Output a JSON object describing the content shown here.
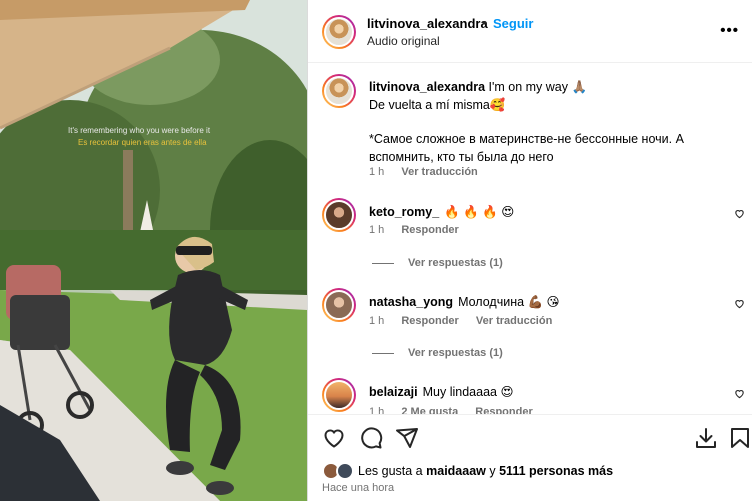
{
  "media": {
    "caption_en": "It's remembering who you were before it",
    "caption_es": "Es recordar quien eras antes de ella"
  },
  "header": {
    "username": "litvinova_alexandra",
    "dot": "•",
    "follow": "Seguir",
    "audio": "Audio original",
    "more": "•••"
  },
  "post": {
    "username": "litvinova_alexandra",
    "line1": "I'm on my way 🙏🏽",
    "line2": "De vuelta a mí misma🥰",
    "line3": "*Самое сложное в материнстве-не бессонные ночи. А вспомнить, кто ты была до него",
    "time": "1 h",
    "translate": "Ver traducción"
  },
  "comments": [
    {
      "username": "keto_romy_",
      "text": "🔥 🔥 🔥 😍",
      "time": "1 h",
      "reply": "Responder",
      "translate": "",
      "replies": "Ver respuestas (1)",
      "avatar_color": "#5a3b2a"
    },
    {
      "username": "natasha_yong",
      "text": "Молодчина 💪🏾 😘",
      "time": "1 h",
      "reply": "Responder",
      "translate": "Ver traducción",
      "replies": "Ver respuestas (1)",
      "avatar_color": "#8a6a55"
    },
    {
      "username": "belaizaji",
      "text": "Muy lindaaaa 😍",
      "time": "1 h",
      "reply": "Responder",
      "likes": "2 Me gusta",
      "avatar_color": "#d9834a"
    }
  ],
  "likes": {
    "prefix": "Les gusta a",
    "user": "maidaaaw",
    "middle": "y",
    "count": "5111 personas más"
  },
  "timestamp": "Hace una hora",
  "colors": {
    "accent": "#0095f6",
    "muted": "#737373"
  },
  "icons": [
    "heart-icon",
    "comment-icon",
    "share-icon",
    "download-icon",
    "bookmark-icon",
    "more-icon"
  ]
}
